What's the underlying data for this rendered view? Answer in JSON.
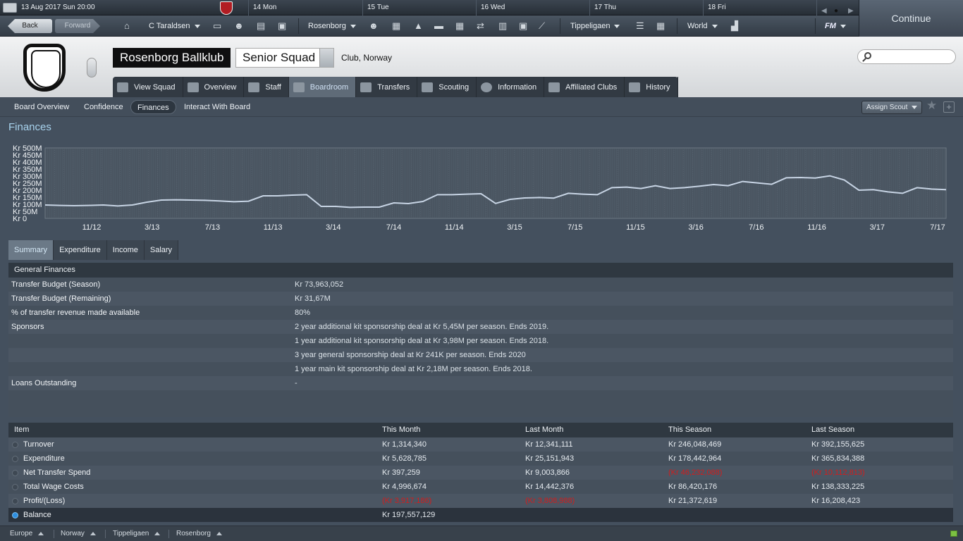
{
  "topbar": {
    "date": "13 Aug 2017  Sun 20:00",
    "days": [
      "14  Mon",
      "15  Tue",
      "16  Wed",
      "17  Thu",
      "18  Fri"
    ]
  },
  "continue_label": "Continue",
  "nav": {
    "back": "Back",
    "forward": "Forward",
    "manager": "C Taraldsen",
    "club": "Rosenborg",
    "league": "Tippeligaen",
    "world": "World",
    "fm": "FM"
  },
  "header": {
    "club_name": "Rosenborg Ballklub",
    "squad": "Senior Squad",
    "location": "Club, Norway",
    "search_placeholder": ""
  },
  "main_tabs": [
    {
      "label": "View Squad",
      "icon": "view-squad-icon"
    },
    {
      "label": "Overview",
      "icon": "overview-icon"
    },
    {
      "label": "Staff",
      "icon": "staff-icon"
    },
    {
      "label": "Boardroom",
      "icon": "boardroom-icon"
    },
    {
      "label": "Transfers",
      "icon": "transfers-icon"
    },
    {
      "label": "Scouting",
      "icon": "scouting-icon"
    },
    {
      "label": "Information",
      "icon": "information-icon"
    },
    {
      "label": "Affiliated Clubs",
      "icon": "affiliated-clubs-icon"
    },
    {
      "label": "History",
      "icon": "history-icon"
    }
  ],
  "active_main_tab": "Boardroom",
  "sub_nav": [
    "Board Overview",
    "Confidence",
    "Finances",
    "Interact With Board"
  ],
  "active_sub_nav": "Finances",
  "assign_scout": "Assign Scout",
  "page_title": "Finances",
  "chart_data": {
    "type": "line",
    "y_ticks": [
      "Kr 500M",
      "Kr 450M",
      "Kr 400M",
      "Kr 350M",
      "Kr 300M",
      "Kr 250M",
      "Kr 200M",
      "Kr 150M",
      "Kr 100M",
      "Kr 50M",
      "Kr 0"
    ],
    "ylim": [
      0,
      500
    ],
    "x_ticks": [
      "11/12",
      "3/13",
      "7/13",
      "11/13",
      "3/14",
      "7/14",
      "11/14",
      "3/15",
      "7/15",
      "11/15",
      "3/16",
      "7/16",
      "11/16",
      "3/17",
      "7/17"
    ],
    "grid": true,
    "series": [
      {
        "color": "#c7d4e4",
        "values": [
          95,
          92,
          90,
          92,
          95,
          88,
          95,
          115,
          130,
          132,
          130,
          128,
          124,
          118,
          122,
          160,
          160,
          165,
          168,
          85,
          85,
          78,
          80,
          80,
          110,
          105,
          120,
          168,
          168,
          172,
          175,
          106,
          135,
          145,
          148,
          144,
          178,
          172,
          168,
          218,
          222,
          212,
          232,
          212,
          218,
          228,
          240,
          232,
          262,
          252,
          242,
          288,
          290,
          286,
          302,
          272,
          200,
          204,
          188,
          178,
          218,
          208,
          204
        ]
      }
    ]
  },
  "sub_tabs": [
    "Summary",
    "Expenditure",
    "Income",
    "Salary"
  ],
  "active_sub_tab": "Summary",
  "general_finances": {
    "title": "General Finances",
    "rows": [
      {
        "label": "Transfer Budget (Season)",
        "value": "Kr 73,963,052"
      },
      {
        "label": "Transfer Budget (Remaining)",
        "value": "Kr 31,67M"
      },
      {
        "label": "% of transfer revenue made available",
        "value": "80%"
      },
      {
        "label": "Sponsors",
        "value": "2 year additional kit sponsorship deal at Kr 5,45M per season. Ends 2019."
      },
      {
        "label": "",
        "value": "1 year additional kit sponsorship deal at Kr 3,98M per season. Ends 2018."
      },
      {
        "label": "",
        "value": "3 year general sponsorship deal at Kr 241K per season. Ends 2020"
      },
      {
        "label": "",
        "value": "1 year main kit sponsorship deal at Kr 2,18M per season. Ends 2018."
      },
      {
        "label": "Loans Outstanding",
        "value": "-"
      }
    ]
  },
  "finance_table": {
    "headers": [
      "Item",
      "This Month",
      "Last Month",
      "This Season",
      "Last Season"
    ],
    "rows": [
      {
        "item": "Turnover",
        "this_month": "Kr 1,314,340",
        "last_month": "Kr 12,341,111",
        "this_season": "Kr 246,048,469",
        "last_season": "Kr 392,155,625"
      },
      {
        "item": "Expenditure",
        "this_month": "Kr 5,628,785",
        "last_month": "Kr 25,151,943",
        "this_season": "Kr 178,442,964",
        "last_season": "Kr 365,834,388"
      },
      {
        "item": "Net Transfer Spend",
        "this_month": "Kr 397,259",
        "last_month": "Kr 9,003,866",
        "this_season": "(Kr 46,232,088)",
        "last_season": "(Kr 10,112,813)"
      },
      {
        "item": "Total Wage Costs",
        "this_month": "Kr 4,996,674",
        "last_month": "Kr 14,442,376",
        "this_season": "Kr 86,420,176",
        "last_season": "Kr 138,333,225"
      },
      {
        "item": "Profit/(Loss)",
        "this_month": "(Kr 3,917,186)",
        "last_month": "(Kr 3,808,988)",
        "this_season": "Kr 21,372,619",
        "last_season": "Kr 16,208,423"
      }
    ],
    "balance": {
      "item": "Balance",
      "value": "Kr 197,557,129"
    },
    "negative_color": "#d21d1d"
  },
  "breadcrumbs": [
    "Europe",
    "Norway",
    "Tippeligaen",
    "Rosenborg"
  ]
}
